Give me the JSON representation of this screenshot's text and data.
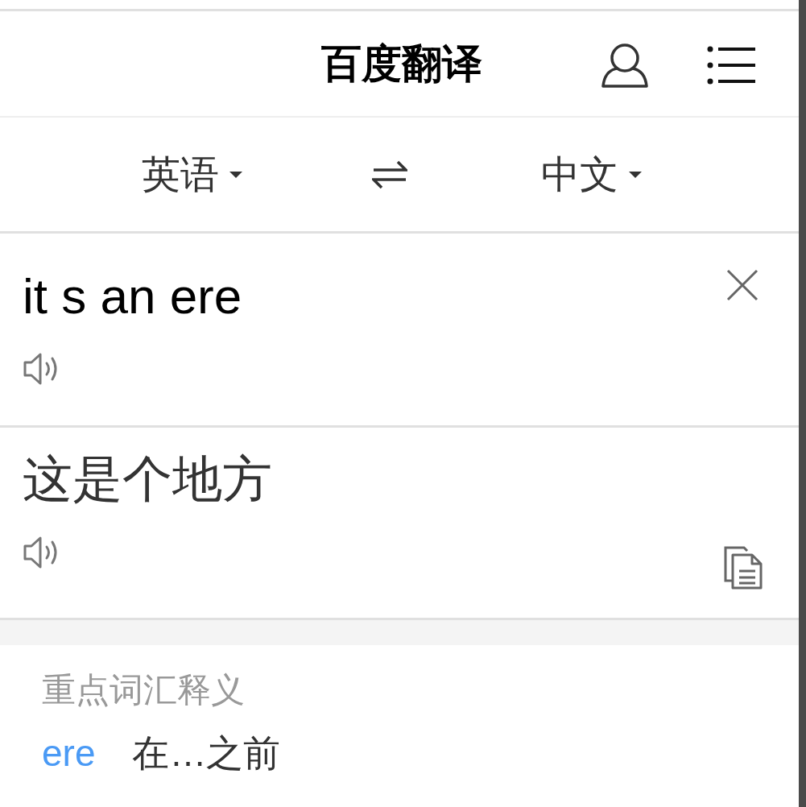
{
  "header": {
    "title": "百度翻译"
  },
  "languages": {
    "source": "英语",
    "target": "中文"
  },
  "input": {
    "text": "it s an ere"
  },
  "output": {
    "text": "这是个地方"
  },
  "key_words": {
    "heading": "重点词汇释义",
    "entries": [
      {
        "word": "ere",
        "meaning": "在…之前"
      }
    ]
  }
}
